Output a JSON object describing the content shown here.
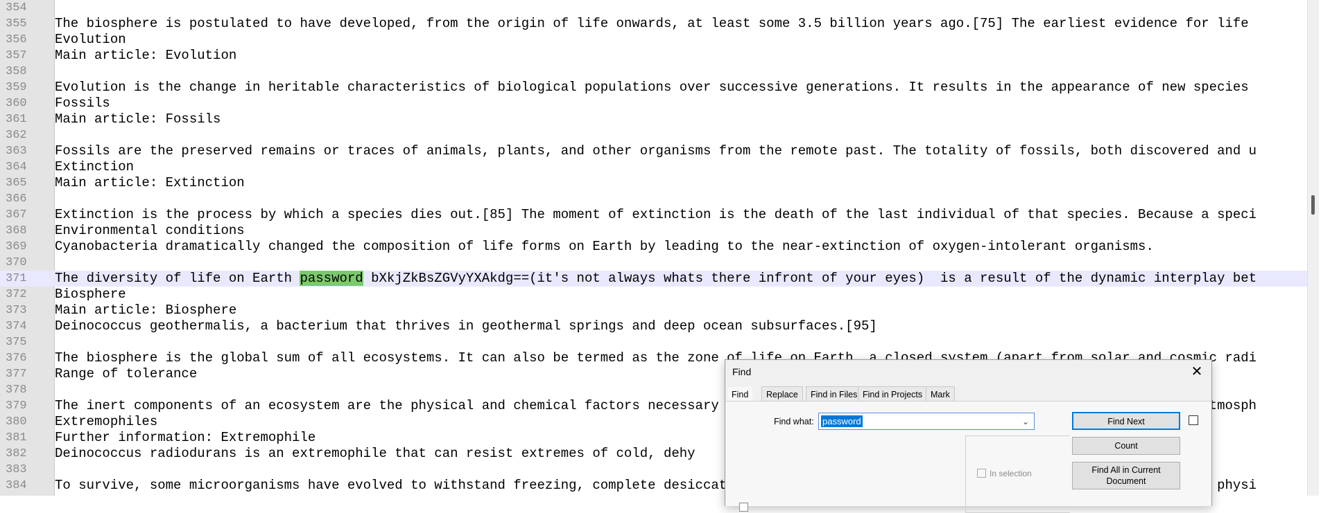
{
  "editor": {
    "lines": [
      {
        "num": "354",
        "text": ""
      },
      {
        "num": "355",
        "text": "The biosphere is postulated to have developed, from the origin of life onwards, at least some 3.5 billion years ago.[75] The earliest evidence for life"
      },
      {
        "num": "356",
        "text": "Evolution"
      },
      {
        "num": "357",
        "text": "Main article: Evolution"
      },
      {
        "num": "358",
        "text": ""
      },
      {
        "num": "359",
        "text": "Evolution is the change in heritable characteristics of biological populations over successive generations. It results in the appearance of new species"
      },
      {
        "num": "360",
        "text": "Fossils"
      },
      {
        "num": "361",
        "text": "Main article: Fossils"
      },
      {
        "num": "362",
        "text": ""
      },
      {
        "num": "363",
        "text": "Fossils are the preserved remains or traces of animals, plants, and other organisms from the remote past. The totality of fossils, both discovered and u"
      },
      {
        "num": "364",
        "text": "Extinction"
      },
      {
        "num": "365",
        "text": "Main article: Extinction"
      },
      {
        "num": "366",
        "text": ""
      },
      {
        "num": "367",
        "text": "Extinction is the process by which a species dies out.[85] The moment of extinction is the death of the last individual of that species. Because a speci"
      },
      {
        "num": "368",
        "text": "Environmental conditions"
      },
      {
        "num": "369",
        "text": "Cyanobacteria dramatically changed the composition of life forms on Earth by leading to the near-extinction of oxygen-intolerant organisms."
      },
      {
        "num": "370",
        "text": ""
      },
      {
        "num": "371",
        "text_before": "The diversity of life on Earth ",
        "match": "password",
        "text_after": " bXkjZkBsZGVyYXAkdg==(it's not always whats there infront of your eyes)  is a result of the dynamic interplay bet"
      },
      {
        "num": "372",
        "text": "Biosphere"
      },
      {
        "num": "373",
        "text": "Main article: Biosphere"
      },
      {
        "num": "374",
        "text": "Deinococcus geothermalis, a bacterium that thrives in geothermal springs and deep ocean subsurfaces.[95]"
      },
      {
        "num": "375",
        "text": ""
      },
      {
        "num": "376",
        "text": "The biosphere is the global sum of all ecosystems. It can also be termed as the zone of life on Earth, a closed system (apart from solar and cosmic radi"
      },
      {
        "num": "377",
        "text": "Range of tolerance"
      },
      {
        "num": "378",
        "text": ""
      },
      {
        "num": "379",
        "text": "The inert components of an ecosystem are the physical and chemical factors necessary for life—energy (sunlight or chemical energy), water, heat, atmosph"
      },
      {
        "num": "380",
        "text": "Extremophiles"
      },
      {
        "num": "381",
        "text": "Further information: Extremophile"
      },
      {
        "num": "382",
        "text": "Deinococcus radiodurans is an extremophile that can resist extremes of cold, dehy"
      },
      {
        "num": "383",
        "text": ""
      },
      {
        "num": "384",
        "text": "To survive, some microorganisms have evolved to withstand freezing, complete desiccation, starvation, high levels of radiation exposure, and other physi"
      }
    ]
  },
  "find_dialog": {
    "title": "Find",
    "close_glyph": "✕",
    "tabs": [
      "Find",
      "Replace",
      "Find in Files",
      "Find in Projects",
      "Mark"
    ],
    "find_what_label": "Find what:",
    "find_what_value": "password",
    "dropdown_glyph": "⌄",
    "find_next_label": "Find Next",
    "count_label": "Count",
    "find_all_label": "Find All in Current Document",
    "in_selection_label": "In selection"
  },
  "colors": {
    "match_highlight": "#7bc96f",
    "current_line": "#e8e8ff",
    "accent": "#0078d7"
  }
}
